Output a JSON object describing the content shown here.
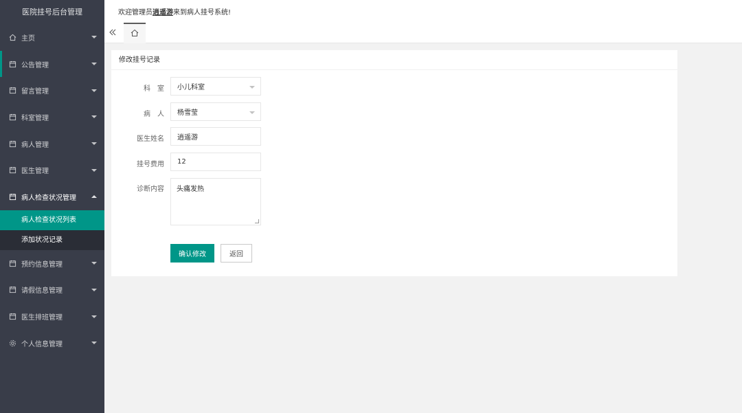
{
  "app": {
    "brand": "医院挂号后台管理"
  },
  "header": {
    "welcome_prefix": "欢迎管理员",
    "username": "逍遥游",
    "welcome_suffix": "来到病人挂号系统!"
  },
  "tabs": {
    "collapse_icon": "double-chevron-left-icon",
    "home_icon": "home-icon"
  },
  "sidebar": {
    "items": [
      {
        "label": "主页",
        "icon": "home-icon"
      },
      {
        "label": "公告管理",
        "icon": "calendar-icon"
      },
      {
        "label": "留言管理",
        "icon": "calendar-icon"
      },
      {
        "label": "科室管理",
        "icon": "calendar-icon"
      },
      {
        "label": "病人管理",
        "icon": "calendar-icon"
      },
      {
        "label": "医生管理",
        "icon": "calendar-icon"
      },
      {
        "label": "病人检查状况管理",
        "icon": "calendar-icon",
        "expanded": true
      },
      {
        "label": "预约信息管理",
        "icon": "calendar-icon"
      },
      {
        "label": "请假信息管理",
        "icon": "calendar-icon"
      },
      {
        "label": "医生排班管理",
        "icon": "calendar-icon"
      },
      {
        "label": "个人信息管理",
        "icon": "gear-icon"
      }
    ],
    "sub_items": [
      {
        "label": "病人检查状况列表",
        "selected": true
      },
      {
        "label": "添加状况记录",
        "selected": false
      }
    ]
  },
  "form": {
    "title": "修改挂号记录",
    "department_label": "科　室",
    "department_value": "小儿科室",
    "patient_label": "病　人",
    "patient_value": "杨雪莹",
    "doctor_label": "医生姓名",
    "doctor_value": "逍遥游",
    "fee_label": "挂号费用",
    "fee_value": "12",
    "diagnosis_label": "诊断内容",
    "diagnosis_value": "头痛发热",
    "confirm_label": "确认修改",
    "back_label": "返回"
  },
  "colors": {
    "sidebar_bg": "#393d49",
    "accent": "#009688"
  }
}
